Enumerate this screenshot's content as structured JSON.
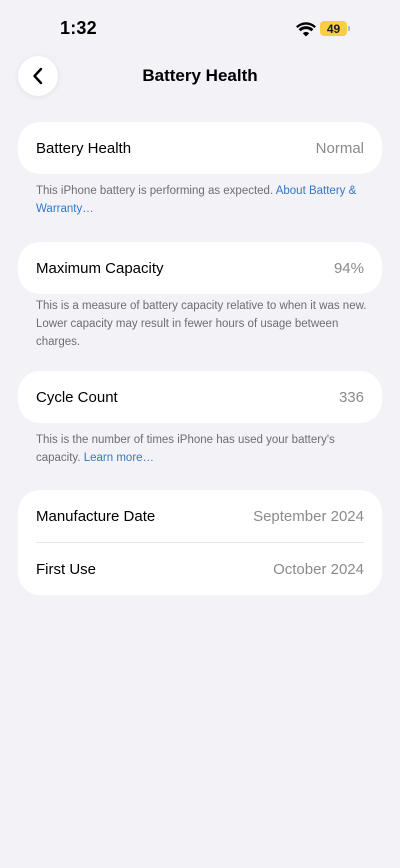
{
  "status_bar": {
    "time": "1:32",
    "battery_level": "49",
    "battery_color": "#f7ce46"
  },
  "nav": {
    "title": "Battery Health",
    "back_icon": "chevron-left-icon"
  },
  "battery_health": {
    "label": "Battery Health",
    "value": "Normal",
    "note": "This iPhone battery is performing as expected. ",
    "link": "About Battery & Warranty…"
  },
  "max_capacity": {
    "label": "Maximum Capacity",
    "value": "94%",
    "note": "This is a measure of battery capacity relative to when it was new. Lower capacity may result in fewer hours of usage between charges."
  },
  "cycle_count": {
    "label": "Cycle Count",
    "value": "336",
    "note": "This is the number of times iPhone has used your battery's capacity. ",
    "link": "Learn more…"
  },
  "dates": {
    "manufacture_label": "Manufacture Date",
    "manufacture_value": "September 2024",
    "first_use_label": "First Use",
    "first_use_value": "October 2024"
  },
  "colors": {
    "accent_link": "#3478c6",
    "background": "#f2f2f7",
    "secondary_text": "#8a8a8e"
  }
}
